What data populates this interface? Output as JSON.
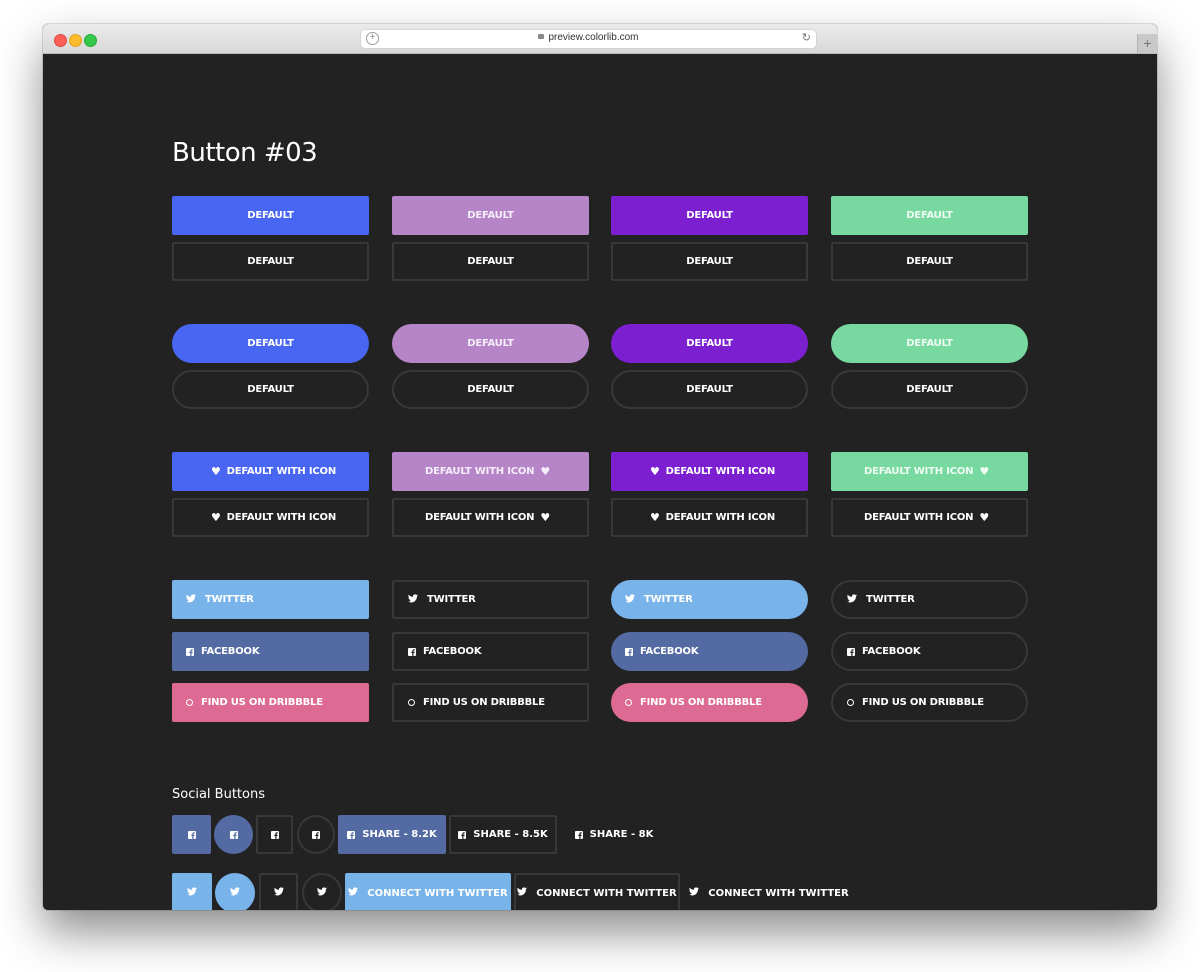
{
  "browser": {
    "url": "preview.colorlib.com",
    "new_tab_label": "+"
  },
  "page": {
    "title": "Button #03",
    "social_heading": "Social Buttons"
  },
  "colors": {
    "blue": "#4866f1",
    "lavender": "#b685c7",
    "purple": "#7b1fd1",
    "mint": "#77d99f",
    "twitter": "#78b3ea",
    "facebook": "#536aa2",
    "dribbble": "#dd6a93",
    "background": "#222222",
    "outline": "#383838"
  },
  "buttons": {
    "default_label": "DEFAULT",
    "icon_label": "DEFAULT WITH ICON",
    "twitter_label": "TWITTER",
    "facebook_label": "FACEBOOK",
    "dribbble_label": "FIND US ON DRIBBBLE"
  },
  "social": {
    "share_buttons": [
      {
        "label": "SHARE - 8.2K"
      },
      {
        "label": "SHARE - 8.5K"
      },
      {
        "label": "SHARE - 8K"
      }
    ],
    "connect_label": "CONNECT WITH TWITTER"
  },
  "icons": {
    "heart": "♥",
    "twitter": "🐦",
    "plus": "+",
    "reload": "↻"
  }
}
